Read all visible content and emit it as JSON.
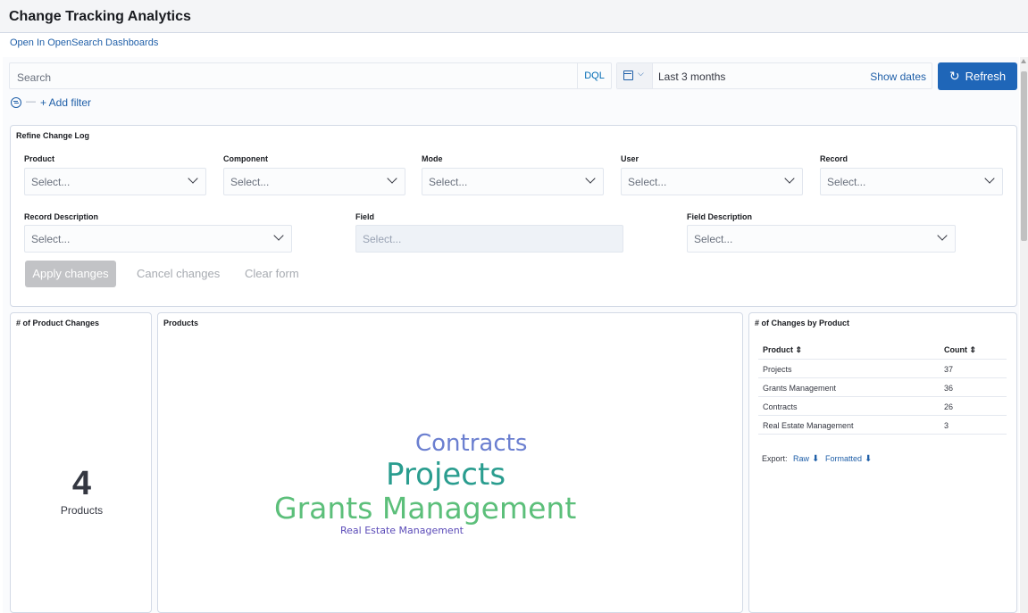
{
  "app": {
    "title": "Change Tracking Analytics",
    "open_link": "Open In OpenSearch Dashboards"
  },
  "query": {
    "search_placeholder": "Search",
    "language": "DQL"
  },
  "time": {
    "range": "Last 3 months",
    "show_dates": "Show dates"
  },
  "refresh": {
    "label": "Refresh",
    "icon": "refresh-icon"
  },
  "filters": {
    "add_label": "+ Add filter",
    "dash": "—"
  },
  "refine": {
    "title": "Refine Change Log",
    "fields": [
      {
        "label": "Product",
        "placeholder": "Select...",
        "enabled": true
      },
      {
        "label": "Component",
        "placeholder": "Select...",
        "enabled": true
      },
      {
        "label": "Mode",
        "placeholder": "Select...",
        "enabled": true
      },
      {
        "label": "User",
        "placeholder": "Select...",
        "enabled": true
      },
      {
        "label": "Record",
        "placeholder": "Select...",
        "enabled": true
      },
      {
        "label": "Record Description",
        "placeholder": "Select...",
        "enabled": true
      },
      {
        "label": "Field",
        "placeholder": "Select...",
        "enabled": false
      },
      {
        "label": "Field Description",
        "placeholder": "Select...",
        "enabled": true
      }
    ],
    "apply": "Apply changes",
    "cancel": "Cancel changes",
    "clear": "Clear form"
  },
  "metric": {
    "title": "# of Product Changes",
    "value": "4",
    "label": "Products"
  },
  "cloud": {
    "title": "Products",
    "words": [
      {
        "text": "Contracts",
        "color": "#6b7fd0"
      },
      {
        "text": "Projects",
        "color": "#2a9d8f"
      },
      {
        "text": "Grants Management",
        "color": "#5cbf7a"
      },
      {
        "text": "Real Estate Management",
        "color": "#5b4bb8"
      }
    ]
  },
  "table": {
    "title": "# of Changes by Product",
    "headers": [
      "Product ⇕",
      "Count ⇕"
    ],
    "rows": [
      [
        "Projects",
        "37"
      ],
      [
        "Grants Management",
        "36"
      ],
      [
        "Contracts",
        "26"
      ],
      [
        "Real Estate Management",
        "3"
      ]
    ],
    "export_label": "Export:",
    "raw": "Raw",
    "formatted": "Formatted"
  }
}
